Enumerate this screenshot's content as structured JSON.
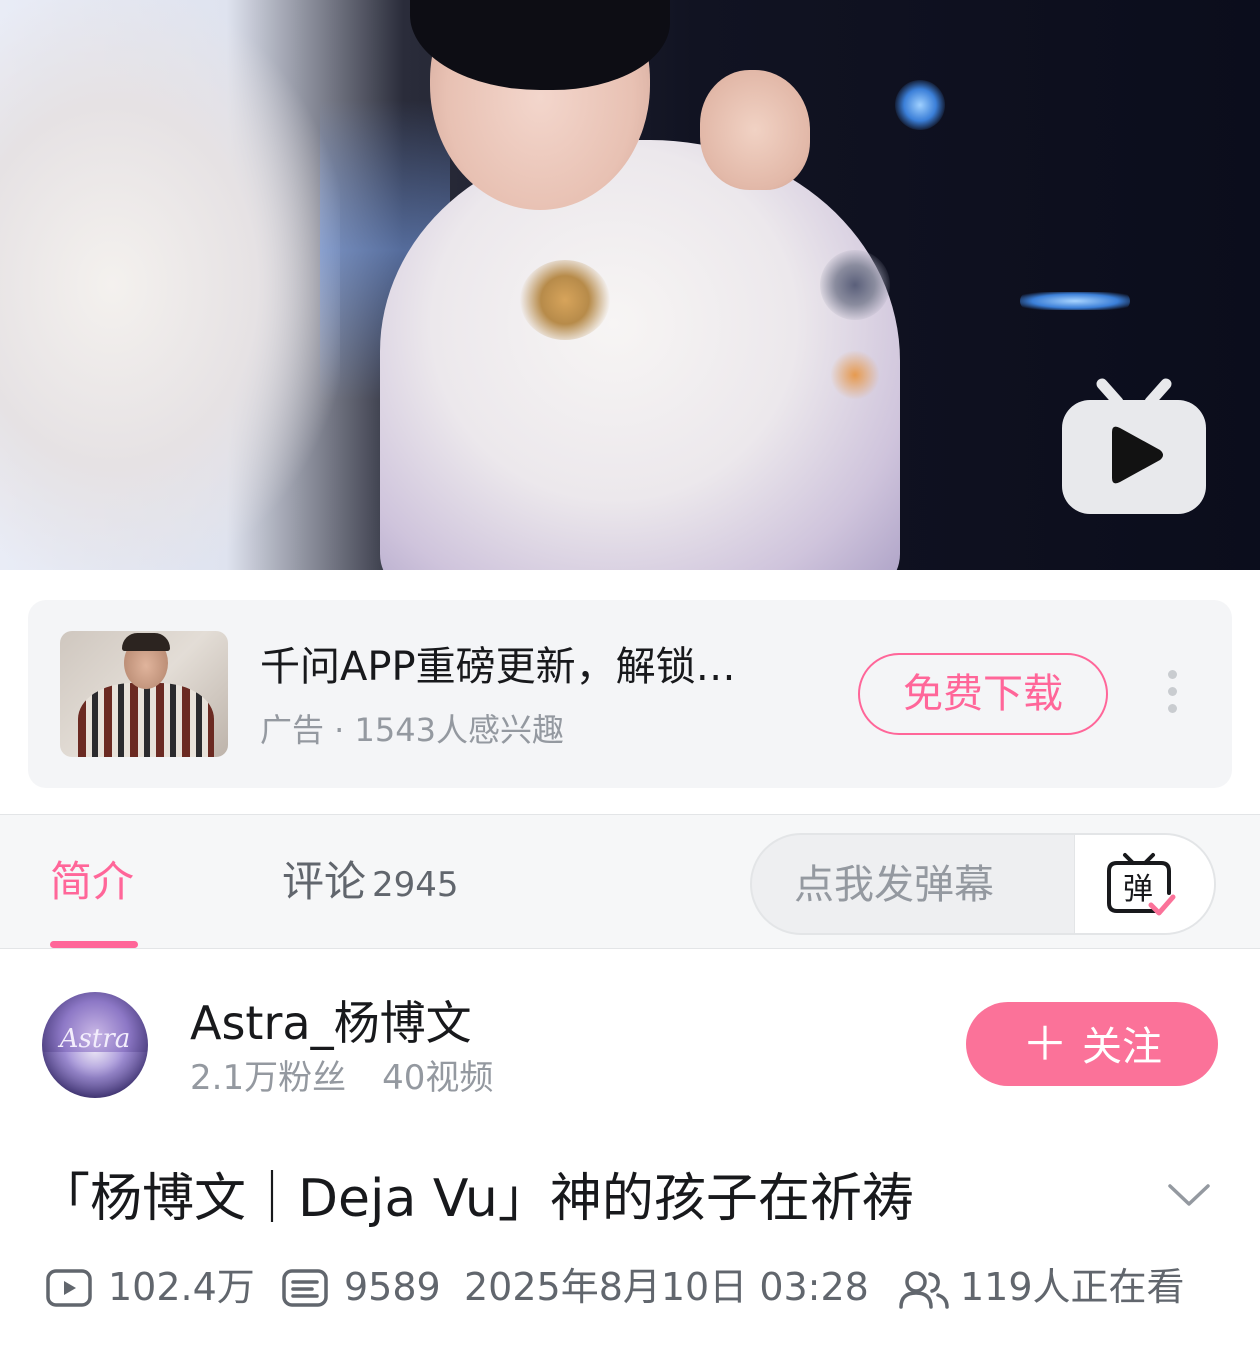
{
  "ad": {
    "title": "千问APP重磅更新，解锁…",
    "meta": "广告 · 1543人感兴趣",
    "cta": "免费下载"
  },
  "tabs": {
    "intro": "简介",
    "comments": "评论",
    "comments_count": "2945"
  },
  "danmaku": {
    "placeholder": "点我发弹幕",
    "button_glyph": "弹"
  },
  "uploader": {
    "avatar_text": "Astra",
    "name": "Astra_杨博文",
    "fans": "2.1万粉丝",
    "videos": "40视频",
    "follow_label": "关注",
    "follow_symbol": "＋"
  },
  "video": {
    "title": "「杨博文｜Deja Vu」神的孩子在祈祷",
    "views": "102.4万",
    "danmaku_count": "9589",
    "publish_time": "2025年8月10日 03:28",
    "watching": "119人正在看"
  },
  "colors": {
    "accent_pink": "#fb7299",
    "text_primary": "#18191c",
    "text_secondary": "#61666d",
    "text_tertiary": "#9499a0"
  }
}
